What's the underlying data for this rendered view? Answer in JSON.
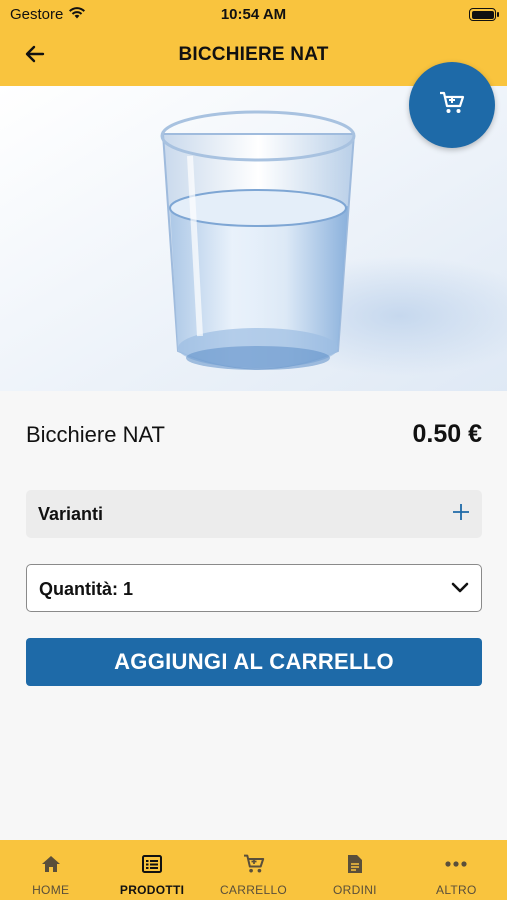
{
  "status_bar": {
    "carrier": "Gestore",
    "time": "10:54 AM"
  },
  "header": {
    "title": "BICCHIERE NAT",
    "back_icon": "arrow-left-icon",
    "cart_icon": "cart-icon"
  },
  "product": {
    "name": "Bicchiere NAT",
    "price": "0.50 €",
    "image": "glass-of-water"
  },
  "variants": {
    "label": "Varianti",
    "icon": "plus-icon"
  },
  "quantity": {
    "label": "Quantità: 1",
    "icon": "chevron-down-icon"
  },
  "add_button": {
    "label": "AGGIUNGI AL CARRELLO"
  },
  "tabs": [
    {
      "label": "HOME",
      "icon": "home-icon",
      "active": false
    },
    {
      "label": "PRODOTTI",
      "icon": "list-icon",
      "active": true
    },
    {
      "label": "CARRELLO",
      "icon": "cart-icon",
      "active": false
    },
    {
      "label": "ORDINI",
      "icon": "document-icon",
      "active": false
    },
    {
      "label": "ALTRO",
      "icon": "more-icon",
      "active": false
    }
  ],
  "colors": {
    "brand_yellow": "#f9c43e",
    "brand_blue": "#1e6aa8",
    "background": "#f7f7f7"
  }
}
